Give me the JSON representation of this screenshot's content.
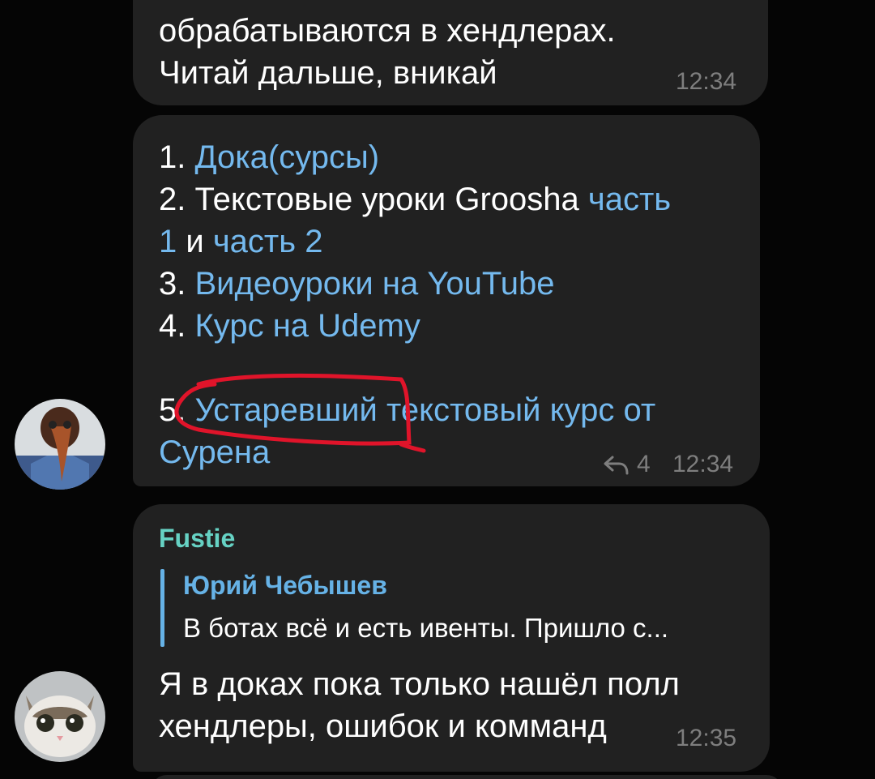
{
  "colors": {
    "background": "#050505",
    "bubble": "#212121",
    "link": "#74b9ee",
    "sender": "#66d2c4",
    "quote_accent": "#66b2e6",
    "timestamp": "#7e7e7e",
    "annotation": "#e0142a"
  },
  "messages": [
    {
      "lines": [
        "обрабатываются в хендлерах.",
        "Читай дальше, вникай"
      ],
      "time": "12:34"
    },
    {
      "items": [
        {
          "num": "1. ",
          "link": "Дока(сурсы)"
        },
        {
          "num": "2. ",
          "text": "Текстовые уроки Groosha ",
          "link": "часть"
        },
        {
          "link_cont": "1",
          "mid": " и ",
          "link2": "часть 2"
        },
        {
          "num": "3. ",
          "link": "Видеоуроки на YouTube"
        },
        {
          "num": "4. ",
          "link": "Курс на Udemy"
        },
        {
          "num": "5.",
          "link": " Устаревший текстовый курс от"
        },
        {
          "link": "Сурена"
        }
      ],
      "replies_icon": "reply-arrow-icon",
      "replies_count": "4",
      "time": "12:34",
      "avatar": "plague-doctor-avatar"
    },
    {
      "sender": "Fustie",
      "quote": {
        "author": "Юрий Чебышев",
        "text": "В ботах всё и есть ивенты. Пришло с..."
      },
      "lines": [
        "Я в доках пока только нашёл полл",
        "хендлеры, ошибок и комманд"
      ],
      "time": "12:35",
      "avatar": "cat-avatar"
    }
  ]
}
